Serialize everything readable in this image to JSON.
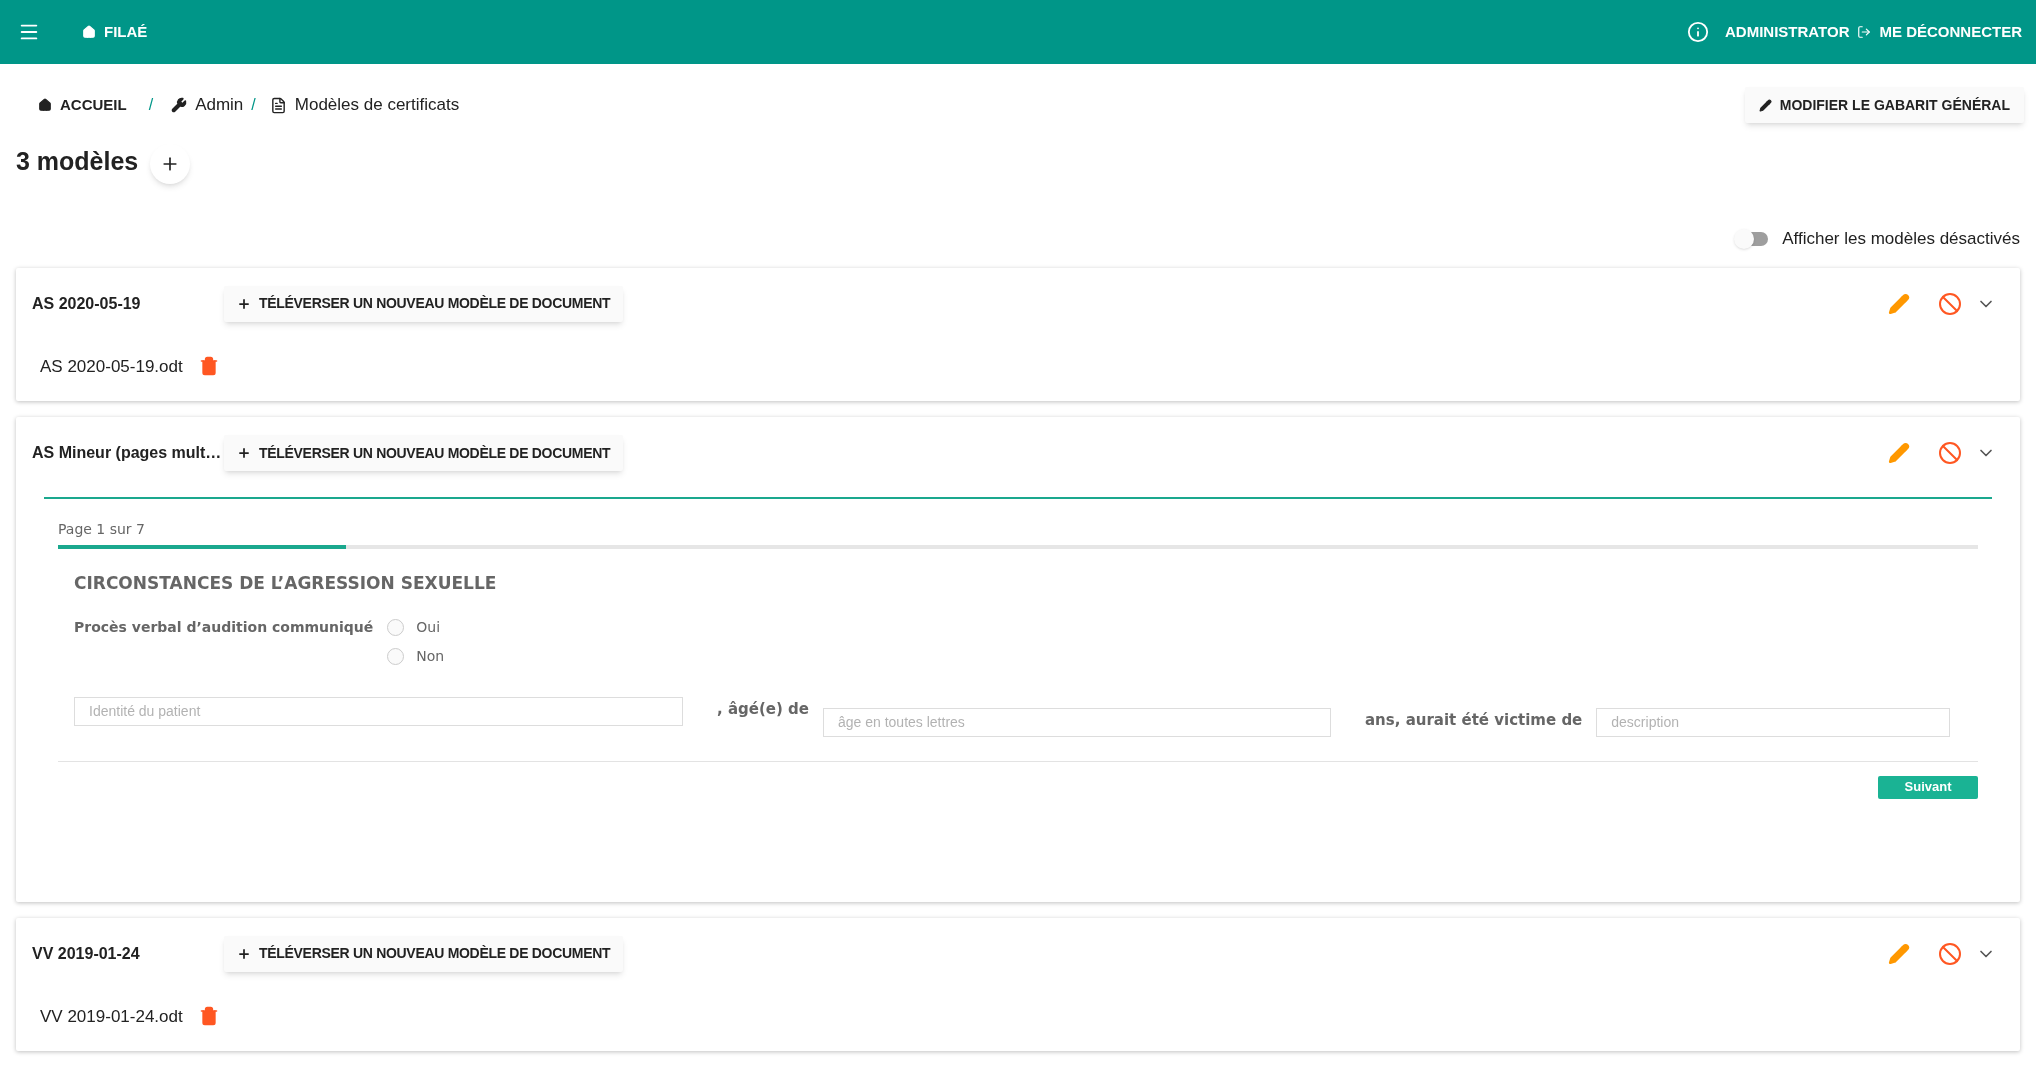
{
  "app_bar": {
    "brand": "FILAÉ",
    "user": "ADMINISTRATOR",
    "logout": "ME DÉCONNECTER"
  },
  "breadcrumb": {
    "items": [
      "ACCUEIL",
      "Admin",
      "Modèles de certificats"
    ],
    "separators": [
      "/",
      "/"
    ]
  },
  "edit_template_button": "MODIFIER LE GABARIT GÉNÉRAL",
  "title": "3 modèles",
  "show_disabled_toggle": {
    "label": "Afficher les modèles désactivés",
    "on": false
  },
  "cards": [
    {
      "kind": "files",
      "title": "AS 2020-05-19",
      "upload_button": "TÉLÉVERSER UN NOUVEAU MODÈLE DE DOCUMENT",
      "files": [
        "AS 2020-05-19.odt"
      ]
    },
    {
      "kind": "form",
      "title": "AS Mineur (pages mult…",
      "upload_button": "TÉLÉVERSER UN NOUVEAU MODÈLE DE DOCUMENT",
      "form": {
        "page": "Page 1 sur 7",
        "level": 0.15,
        "heading": "CIRCONSTANCES DE L’AGRESSION SEXUELLE",
        "question": "Procès verbal d’audition communiqué",
        "options": [
          {
            "label": "Oui",
            "selected": false
          },
          {
            "label": "Non",
            "selected": false
          }
        ],
        "patient_placeholder": "Identité du patient",
        "age_label": ", âgé(e) de",
        "age_placeholder": "âge en toutes lettres",
        "victim_label": "ans, aurait été victime de",
        "description_placeholder": "description",
        "next_button": "Suivant"
      }
    },
    {
      "kind": "files",
      "title": "VV 2019-01-24",
      "upload_button": "TÉLÉVERSER UN NOUVEAU MODÈLE DE DOCUMENT",
      "files": [
        "VV 2019-01-24.odt"
      ]
    }
  ]
}
